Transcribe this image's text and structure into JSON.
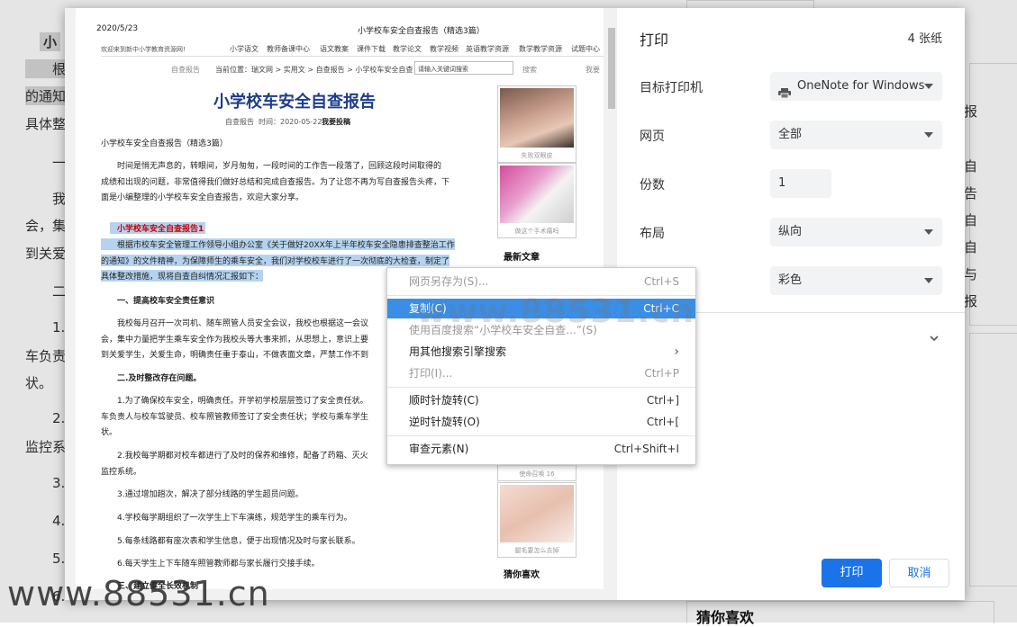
{
  "background": {
    "left_lines": [
      "小",
      "根",
      "的通知",
      "具体整",
      "一",
      "我",
      "会，集",
      "到关爱",
      "二",
      "1.",
      "车负责",
      "状。",
      "2.",
      "监控系",
      "3.",
      "4.",
      "5.",
      "6."
    ],
    "right_lines": [
      "报",
      "自",
      "告",
      "自",
      "自",
      "与",
      "报"
    ],
    "bottom_right_heading": "猜你喜欢"
  },
  "preview": {
    "date": "2020/5/23",
    "header_title": "小学校车安全自查报告（精选3篇）",
    "welcome": "欢迎来到新中小学教育资源网!",
    "nav_links": [
      "小学语文",
      "教师备课中心",
      "语文教案",
      "课件下载",
      "教学论文",
      "教学视频",
      "英语教学资源",
      "数学教学资源",
      "试题中心"
    ],
    "breadcrumb_prefix": "自查报告",
    "breadcrumb": "当前位置：瑞文网 > 实用文 > 自查报告 > 小学校车安全自查",
    "search_placeholder": "请输入关键词搜索",
    "search_button": "搜索",
    "search_extra": "我要",
    "article_title": "小学校车安全自查报告",
    "meta_category": "自查报告",
    "meta_time": "时间：2020-05-22",
    "meta_submit": "我要投稿",
    "subtitle": "小学校车安全自查报告（精选3篇）",
    "intro_1": "时间是悄无声息的，转眼间，岁月匆匆，一段时间的工作告一段落了，回顾这段时间取得的",
    "intro_2": "成绩和出现的问题，非常值得我们做好总结和完成自查报告。为了让您不再为写自查报告头疼，下",
    "intro_3": "面是小编整理的小学校车安全自查报告，欢迎大家分享。",
    "section_heading": "小学校车安全自查报告1",
    "sel_1": "根据市校车安全管理工作领导小组办公室《关于做好20XX年上半年校车安全隐患排查整治工作",
    "sel_2": "的通知》的文件精神，为保障师生的乘车安全，我们对学校校车进行了一次彻底的大检查，制定了",
    "sel_3": "具体整改措施，现将自查自纠情况汇报如下：",
    "h1": "一、提高校车安全责任意识",
    "p1_1": "我校每月召开一次司机、随车照管人员安全会议，我校也根据这一会议",
    "p1_2": "会，集中力量把学生乘车安全作为我校头等大事来抓，从思想上，意识上要",
    "p1_3": "到关爱学生，关爱生命，明确责任重于泰山，不做表面文章，严禁工作不到",
    "h2": "二.及时整改存在问题。",
    "p2_1": "1.为了确保校车安全，明确责任。开学初学校层层签订了安全责任状。",
    "p2_2": "车负责人与校车驾驶员、校车照管教师签订了安全责任状；学校与乘车学生",
    "p2_3": "状。",
    "p3_1": "2.我校每学期都对校车都进行了及时的保养和维修，配备了药箱、灭火",
    "p3_2": "监控系统。",
    "p4": "3.通过增加趟次，解决了部分线路的学生超员问题。",
    "p5": "4.学校每学期组织了一次学生上下车演练，规范学生的乘车行为。",
    "p6": "5.每条线路都有座次表和学生信息，便于出现情况及时与家长联系。",
    "p7": "6.每天学生上下车随车照管教师都与家长履行交接手续。",
    "h3": "三、建立健全长效机制",
    "thumb_captions": [
      "失败双眼皮",
      "做这个手术痛吗",
      "使命召唤 16",
      "腿毛要怎么去掉"
    ],
    "latest_heading": "最新文章",
    "guess_heading": "猜你喜欢"
  },
  "settings": {
    "title": "打印",
    "sheet_count": "4 张纸",
    "printer_label": "目标打印机",
    "printer_value": "OneNote for Windows",
    "pages_label": "网页",
    "pages_value": "全部",
    "copies_label": "份数",
    "copies_value": "1",
    "layout_label": "布局",
    "layout_value": "纵向",
    "color_value": "彩色",
    "print_button": "打印",
    "cancel_button": "取消"
  },
  "context_menu": {
    "items": [
      {
        "label": "网页另存为(S)...",
        "shortcut": "Ctrl+S"
      },
      {
        "label": "复制(C)",
        "shortcut": "Ctrl+C"
      },
      {
        "label": "使用百度搜索“小学校车安全自查...”(S)",
        "shortcut": ""
      },
      {
        "label": "用其他搜索引擎搜索",
        "shortcut": "›"
      },
      {
        "label": "打印(I)...",
        "shortcut": "Ctrl+P"
      },
      {
        "label": "顺时针旋转(C)",
        "shortcut": "Ctrl+]"
      },
      {
        "label": "逆时针旋转(O)",
        "shortcut": "Ctrl+["
      },
      {
        "label": "审查元素(N)",
        "shortcut": "Ctrl+Shift+I"
      }
    ]
  },
  "watermarks": {
    "center": "www.88531.cn",
    "bottom": "www.88531.cn"
  },
  "colors": {
    "accent": "#1a73e8",
    "highlight": "#b5d3f0",
    "menu_hover": "#3a8ee6"
  }
}
